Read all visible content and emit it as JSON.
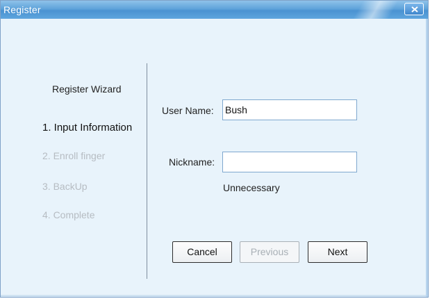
{
  "window": {
    "title": "Register"
  },
  "wizard": {
    "title": "Register Wizard",
    "steps": [
      {
        "label": "1. Input Information",
        "state": "active"
      },
      {
        "label": "2. Enroll finger",
        "state": "inactive"
      },
      {
        "label": "3. BackUp",
        "state": "inactive"
      },
      {
        "label": "4. Complete",
        "state": "inactive"
      }
    ]
  },
  "form": {
    "username_label": "User Name:",
    "username_value": "Bush",
    "nickname_label": "Nickname:",
    "nickname_value": "",
    "nickname_hint": "Unnecessary"
  },
  "buttons": {
    "cancel": "Cancel",
    "previous": "Previous",
    "next": "Next"
  },
  "colors": {
    "titlebar": "#4a92d2",
    "background": "#e8f3fb",
    "inactive_step": "#b6bcc2"
  }
}
